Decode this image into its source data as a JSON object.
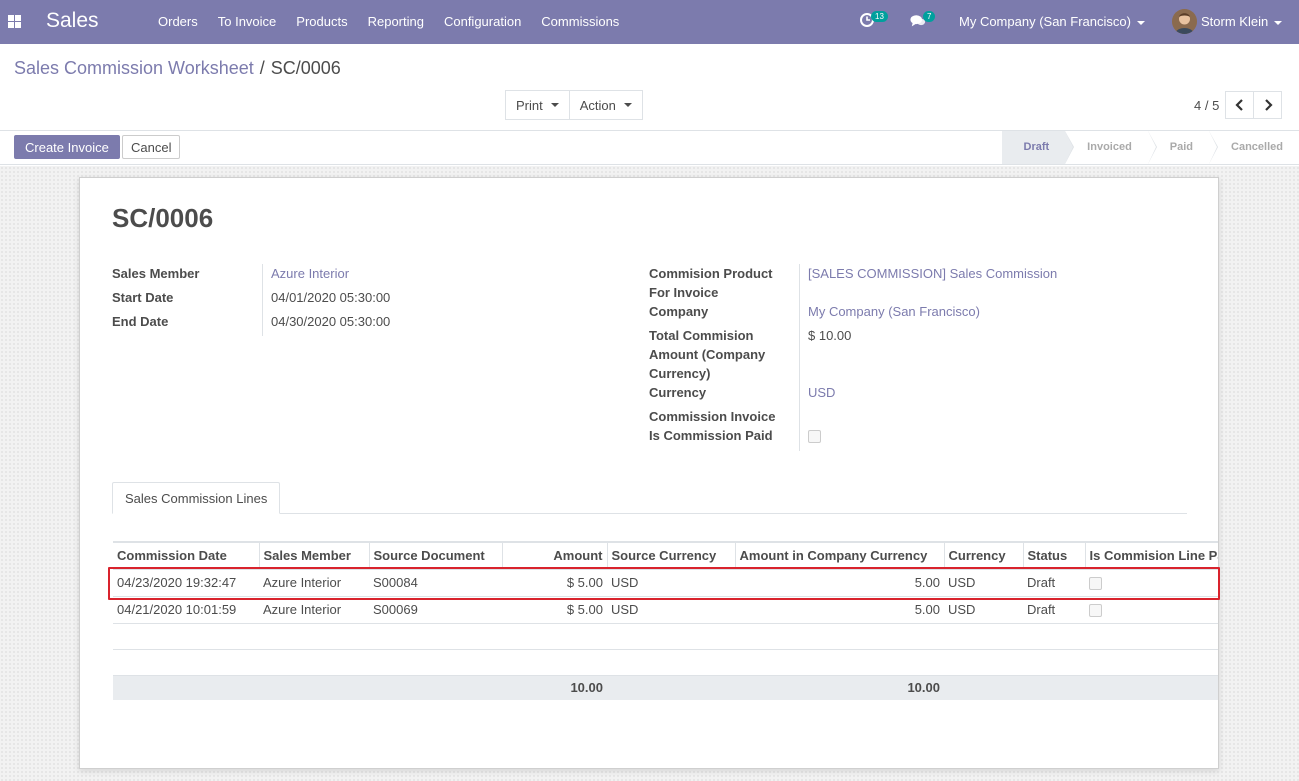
{
  "navbar": {
    "app_name": "Sales",
    "menu": [
      "Orders",
      "To Invoice",
      "Products",
      "Reporting",
      "Configuration",
      "Commissions"
    ],
    "activity_count": "13",
    "message_count": "7",
    "company": "My Company (San Francisco)",
    "user": "Storm Klein"
  },
  "breadcrumb": {
    "parent": "Sales Commission Worksheet",
    "separator": "/",
    "current": "SC/0006"
  },
  "toolbar": {
    "print_label": "Print",
    "action_label": "Action",
    "pager": "4 / 5"
  },
  "statusbar": {
    "create_invoice_label": "Create Invoice",
    "cancel_label": "Cancel",
    "stages": [
      "Draft",
      "Invoiced",
      "Paid",
      "Cancelled"
    ],
    "active_stage": "Draft"
  },
  "record": {
    "title": "SC/0006",
    "left": {
      "sales_member_label": "Sales Member",
      "sales_member": "Azure Interior",
      "start_date_label": "Start Date",
      "start_date": "04/01/2020 05:30:00",
      "end_date_label": "End Date",
      "end_date": "04/30/2020 05:30:00"
    },
    "right": {
      "product_label_1": "Commision Product",
      "product_label_2": "For Invoice",
      "product": "[SALES COMMISSION] Sales Commission",
      "company_label": "Company",
      "company": "My Company (San Francisco)",
      "total_label_1": "Total Commision",
      "total_label_2": "Amount (Company",
      "total_label_3": "Currency)",
      "total": "$ 10.00",
      "currency_label": "Currency",
      "currency": "USD",
      "invoice_label": "Commission Invoice",
      "paid_label": "Is Commission Paid"
    }
  },
  "tab": {
    "label": "Sales Commission Lines"
  },
  "lines_table": {
    "headers": [
      "Commission Date",
      "Sales Member",
      "Source Document",
      "Amount",
      "Source Currency",
      "Amount in Company Currency",
      "Currency",
      "Status",
      "Is Commision Line Paid"
    ],
    "rows": [
      [
        "04/23/2020 19:32:47",
        "Azure Interior",
        "S00084",
        "$ 5.00",
        "USD",
        "5.00",
        "USD",
        "Draft"
      ],
      [
        "04/21/2020 10:01:59",
        "Azure Interior",
        "S00069",
        "$ 5.00",
        "USD",
        "5.00",
        "USD",
        "Draft"
      ]
    ],
    "totals": {
      "amount": "10.00",
      "company_amount": "10.00"
    }
  },
  "colors": {
    "brand": "#7c7bad",
    "badge": "#00a09d",
    "highlight": "#d9232d"
  }
}
